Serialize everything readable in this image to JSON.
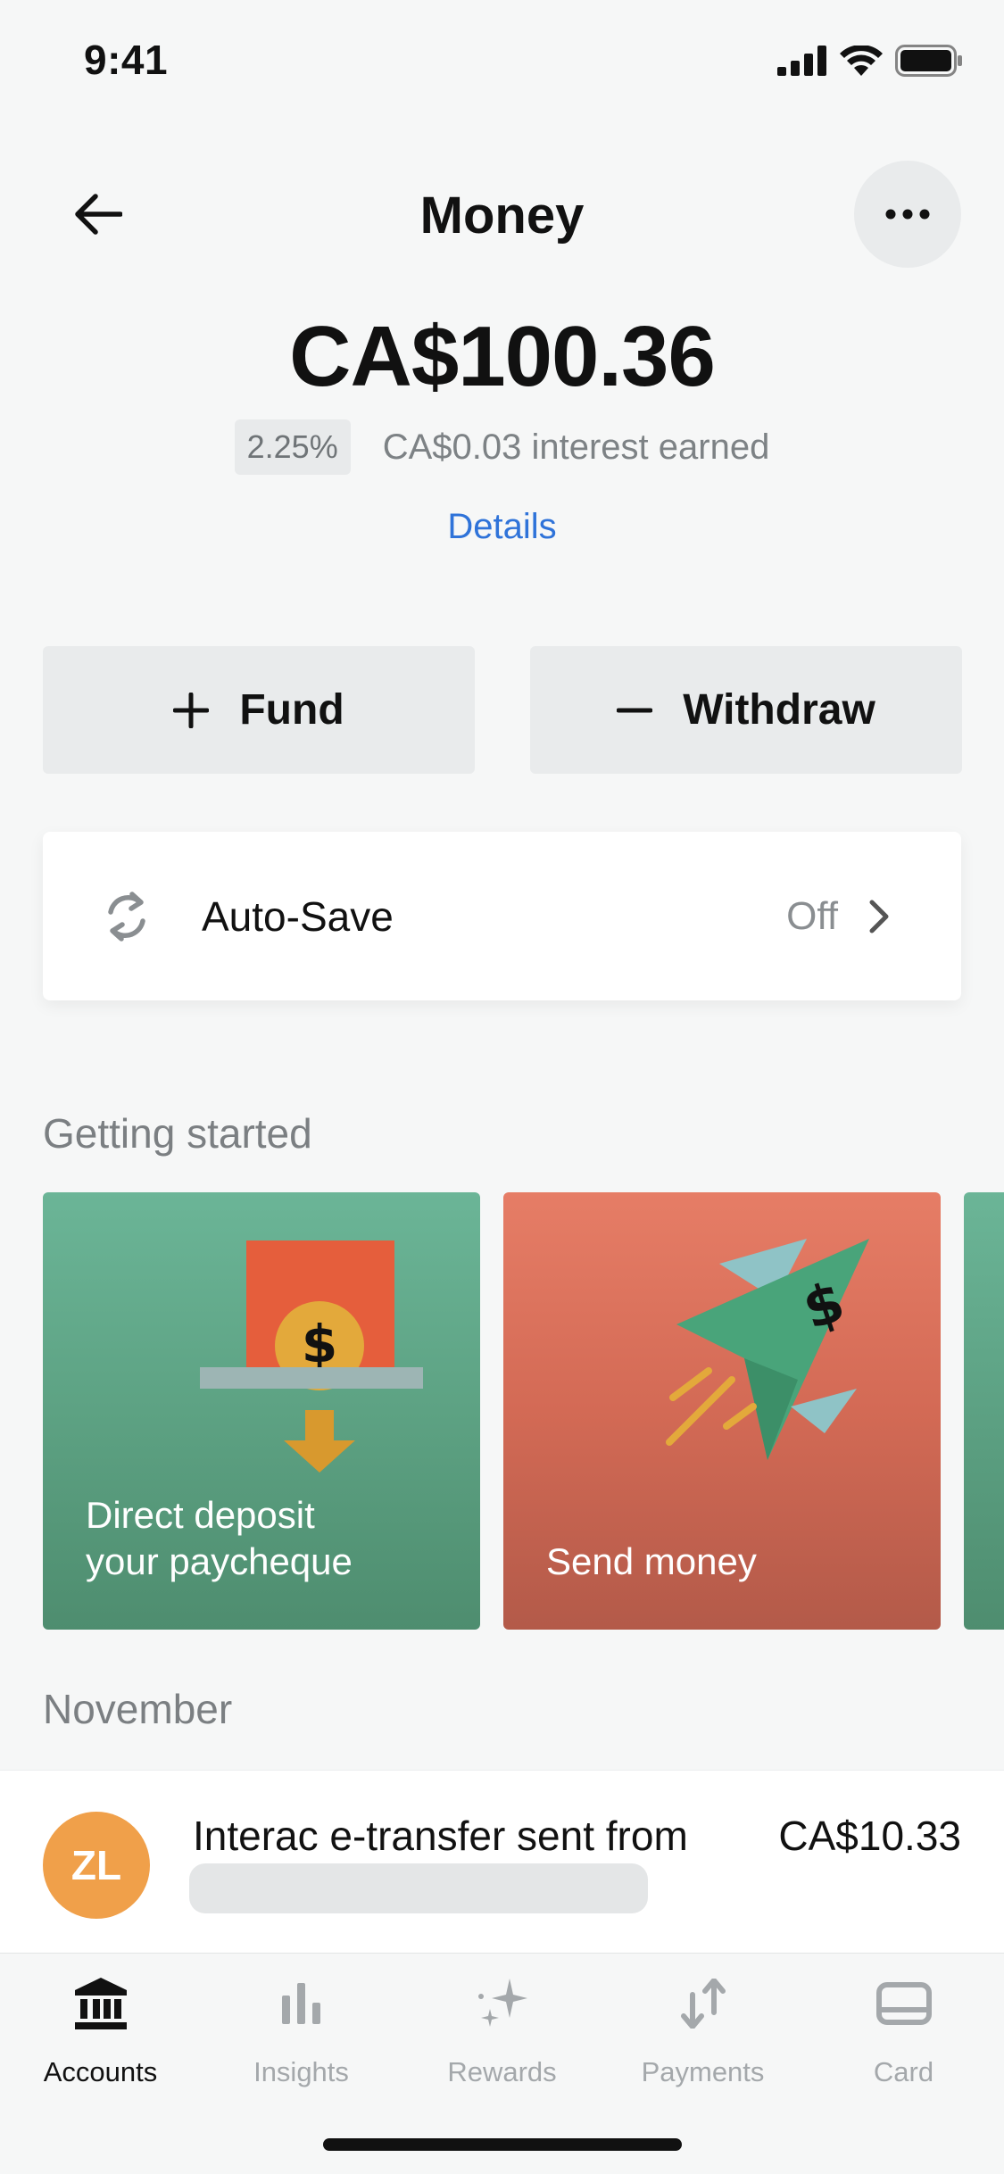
{
  "status_bar": {
    "time": "9:41"
  },
  "header": {
    "title": "Money"
  },
  "balance": {
    "amount": "CA$100.36",
    "rate": "2.25%",
    "interest_text": "CA$0.03 interest earned",
    "details_label": "Details"
  },
  "actions": {
    "fund_label": "Fund",
    "withdraw_label": "Withdraw"
  },
  "auto_save": {
    "label": "Auto-Save",
    "value": "Off"
  },
  "getting_started": {
    "title": "Getting started",
    "cards": [
      {
        "label_line1": "Direct deposit",
        "label_line2": "your paycheque"
      },
      {
        "label": "Send money"
      }
    ]
  },
  "transactions": {
    "month": "November",
    "items": [
      {
        "initials": "ZL",
        "title": "Interac e-transfer sent from",
        "amount": "CA$10.33"
      }
    ]
  },
  "tabbar": {
    "tabs": [
      {
        "label": "Accounts",
        "icon": "bank-icon",
        "active": true
      },
      {
        "label": "Insights",
        "icon": "bar-chart-icon",
        "active": false
      },
      {
        "label": "Rewards",
        "icon": "sparkle-icon",
        "active": false
      },
      {
        "label": "Payments",
        "icon": "transfer-arrows-icon",
        "active": false
      },
      {
        "label": "Card",
        "icon": "card-icon",
        "active": false
      }
    ]
  },
  "colors": {
    "link": "#2f73d9",
    "avatar": "#f0a04a",
    "card_green": "#5da283",
    "card_red": "#d36a55"
  }
}
